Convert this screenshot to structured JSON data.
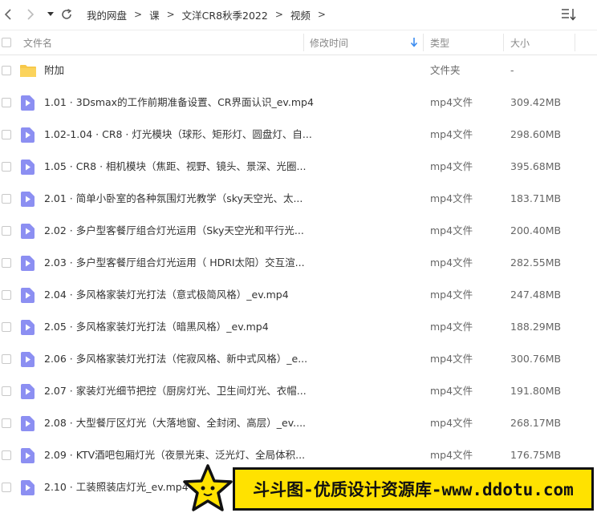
{
  "breadcrumb": [
    "我的网盘",
    "课",
    "文洋CR8秋季2022",
    "视频"
  ],
  "columns": {
    "name": "文件名",
    "modified": "修改时间",
    "type": "类型",
    "size": "大小"
  },
  "rows": [
    {
      "name": "附加",
      "type": "文件夹",
      "size": "-",
      "kind": "folder"
    },
    {
      "name": "1.01 · 3Dsmax的工作前期准备设置、CR界面认识_ev.mp4",
      "type": "mp4文件",
      "size": "309.42MB",
      "kind": "video"
    },
    {
      "name": "1.02-1.04 · CR8 · 灯光模块（球形、矩形灯、圆盘灯、自...",
      "type": "mp4文件",
      "size": "298.60MB",
      "kind": "video"
    },
    {
      "name": "1.05 · CR8 · 相机模块（焦距、视野、镜头、景深、光圈...",
      "type": "mp4文件",
      "size": "395.68MB",
      "kind": "video"
    },
    {
      "name": "2.01 · 简单小卧室的各种氛围灯光教学（sky天空光、太...",
      "type": "mp4文件",
      "size": "183.71MB",
      "kind": "video"
    },
    {
      "name": "2.02 · 多户型客餐厅组合灯光运用（Sky天空光和平行光...",
      "type": "mp4文件",
      "size": "200.40MB",
      "kind": "video"
    },
    {
      "name": "2.03 · 多户型客餐厅组合灯光运用（ HDRI太阳）交互渲...",
      "type": "mp4文件",
      "size": "282.55MB",
      "kind": "video"
    },
    {
      "name": "2.04 · 多风格家装灯光打法（意式极简风格）_ev.mp4",
      "type": "mp4文件",
      "size": "247.48MB",
      "kind": "video"
    },
    {
      "name": "2.05 · 多风格家装灯光打法（暗黑风格）_ev.mp4",
      "type": "mp4文件",
      "size": "188.29MB",
      "kind": "video"
    },
    {
      "name": "2.06 · 多风格家装灯光打法（侘寂风格、新中式风格）_e...",
      "type": "mp4文件",
      "size": "300.76MB",
      "kind": "video"
    },
    {
      "name": "2.07 · 家装灯光细节把控（厨房灯光、卫生间灯光、衣帽...",
      "type": "mp4文件",
      "size": "191.80MB",
      "kind": "video"
    },
    {
      "name": "2.08 · 大型餐厅区灯光（大落地窗、全封闭、高层）_ev....",
      "type": "mp4文件",
      "size": "268.17MB",
      "kind": "video"
    },
    {
      "name": "2.09 · KTV酒吧包厢灯光（夜景光束、泛光灯、全局体积...",
      "type": "mp4文件",
      "size": "176.75MB",
      "kind": "video"
    },
    {
      "name": "2.10 · 工装照装店灯光_ev.mp4",
      "type": "",
      "size": "",
      "kind": "video"
    }
  ],
  "watermark": {
    "text": "斗斗图-优质设计资源库-www.ddotu.com"
  },
  "colors": {
    "video_icon": "#8c8ff2",
    "folder_icon": "#f7c84a",
    "accent_arrow": "#3b8cf0",
    "banner": "#ffe200"
  }
}
